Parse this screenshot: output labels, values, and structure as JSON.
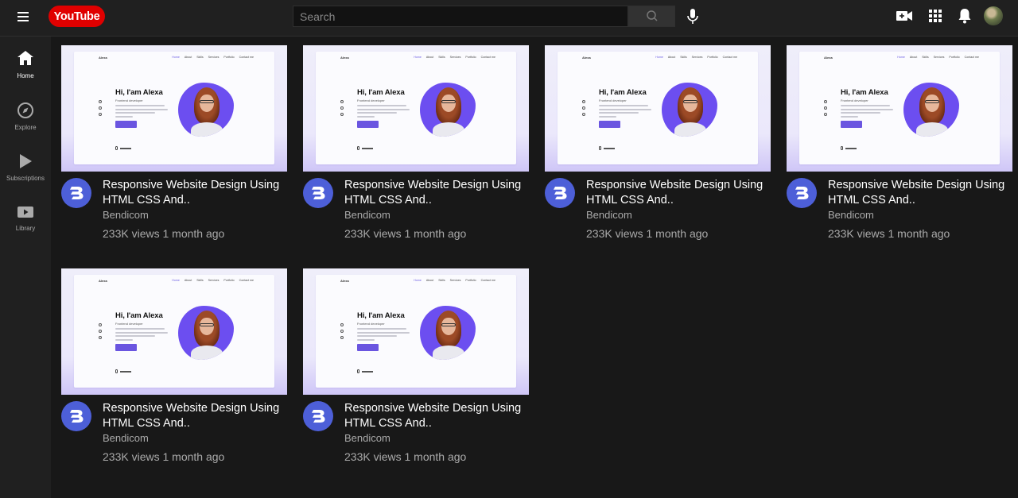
{
  "header": {
    "logo_text": "YouTube",
    "search_placeholder": "Search",
    "icons": [
      "menu-icon",
      "search-icon",
      "mic-icon",
      "create-video-icon",
      "apps-icon",
      "notifications-icon",
      "account-avatar"
    ]
  },
  "sidebar": {
    "items": [
      {
        "label": "Home",
        "icon": "home-icon",
        "active": true
      },
      {
        "label": "Explore",
        "icon": "compass-icon",
        "active": false
      },
      {
        "label": "Subscriptions",
        "icon": "subscriptions-icon",
        "active": false
      },
      {
        "label": "Library",
        "icon": "library-icon",
        "active": false
      }
    ]
  },
  "thumbnail": {
    "hero_title": "Hi, I'am Alexa",
    "hero_subtitle": "Frontend developer",
    "site_logo": "Alexa",
    "site_nav": [
      "Home",
      "About",
      "Skills",
      "Services",
      "Portfolio",
      "Contact me"
    ],
    "scroll_text": "Scroll down"
  },
  "videos": [
    {
      "title": "Responsive Website Design Using HTML CSS And..",
      "channel": "Bendicom",
      "meta": "233K views 1 month ago"
    },
    {
      "title": "Responsive Website Design Using HTML CSS And..",
      "channel": "Bendicom",
      "meta": "233K views 1 month ago"
    },
    {
      "title": "Responsive Website Design Using HTML CSS And..",
      "channel": "Bendicom",
      "meta": "233K views 1 month ago"
    },
    {
      "title": "Responsive Website Design Using HTML CSS And..",
      "channel": "Bendicom",
      "meta": "233K views 1 month ago"
    },
    {
      "title": "Responsive Website Design Using HTML CSS And..",
      "channel": "Bendicom",
      "meta": "233K views 1 month ago"
    },
    {
      "title": "Responsive Website Design Using HTML CSS And..",
      "channel": "Bendicom",
      "meta": "233K views 1 month ago"
    }
  ],
  "colors": {
    "background": "#181818",
    "topbar": "#202020",
    "brand_red": "#e00000",
    "thumbnail_accent": "#6c4ef0",
    "channel_avatar": "#4d5fd8"
  }
}
